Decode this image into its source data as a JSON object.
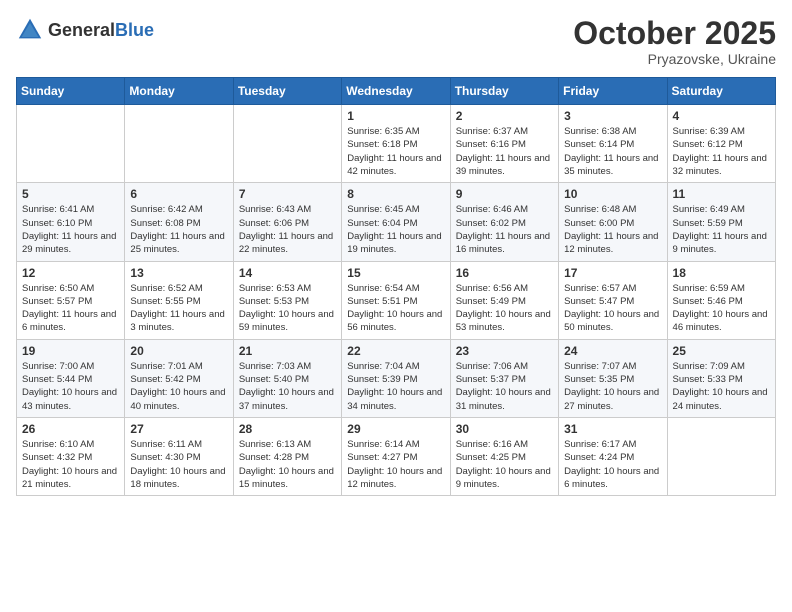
{
  "logo": {
    "text_general": "General",
    "text_blue": "Blue"
  },
  "header": {
    "month": "October 2025",
    "location": "Pryazovske, Ukraine"
  },
  "days_of_week": [
    "Sunday",
    "Monday",
    "Tuesday",
    "Wednesday",
    "Thursday",
    "Friday",
    "Saturday"
  ],
  "weeks": [
    [
      {
        "day": "",
        "sunrise": "",
        "sunset": "",
        "daylight": ""
      },
      {
        "day": "",
        "sunrise": "",
        "sunset": "",
        "daylight": ""
      },
      {
        "day": "",
        "sunrise": "",
        "sunset": "",
        "daylight": ""
      },
      {
        "day": "1",
        "sunrise": "Sunrise: 6:35 AM",
        "sunset": "Sunset: 6:18 PM",
        "daylight": "Daylight: 11 hours and 42 minutes."
      },
      {
        "day": "2",
        "sunrise": "Sunrise: 6:37 AM",
        "sunset": "Sunset: 6:16 PM",
        "daylight": "Daylight: 11 hours and 39 minutes."
      },
      {
        "day": "3",
        "sunrise": "Sunrise: 6:38 AM",
        "sunset": "Sunset: 6:14 PM",
        "daylight": "Daylight: 11 hours and 35 minutes."
      },
      {
        "day": "4",
        "sunrise": "Sunrise: 6:39 AM",
        "sunset": "Sunset: 6:12 PM",
        "daylight": "Daylight: 11 hours and 32 minutes."
      }
    ],
    [
      {
        "day": "5",
        "sunrise": "Sunrise: 6:41 AM",
        "sunset": "Sunset: 6:10 PM",
        "daylight": "Daylight: 11 hours and 29 minutes."
      },
      {
        "day": "6",
        "sunrise": "Sunrise: 6:42 AM",
        "sunset": "Sunset: 6:08 PM",
        "daylight": "Daylight: 11 hours and 25 minutes."
      },
      {
        "day": "7",
        "sunrise": "Sunrise: 6:43 AM",
        "sunset": "Sunset: 6:06 PM",
        "daylight": "Daylight: 11 hours and 22 minutes."
      },
      {
        "day": "8",
        "sunrise": "Sunrise: 6:45 AM",
        "sunset": "Sunset: 6:04 PM",
        "daylight": "Daylight: 11 hours and 19 minutes."
      },
      {
        "day": "9",
        "sunrise": "Sunrise: 6:46 AM",
        "sunset": "Sunset: 6:02 PM",
        "daylight": "Daylight: 11 hours and 16 minutes."
      },
      {
        "day": "10",
        "sunrise": "Sunrise: 6:48 AM",
        "sunset": "Sunset: 6:00 PM",
        "daylight": "Daylight: 11 hours and 12 minutes."
      },
      {
        "day": "11",
        "sunrise": "Sunrise: 6:49 AM",
        "sunset": "Sunset: 5:59 PM",
        "daylight": "Daylight: 11 hours and 9 minutes."
      }
    ],
    [
      {
        "day": "12",
        "sunrise": "Sunrise: 6:50 AM",
        "sunset": "Sunset: 5:57 PM",
        "daylight": "Daylight: 11 hours and 6 minutes."
      },
      {
        "day": "13",
        "sunrise": "Sunrise: 6:52 AM",
        "sunset": "Sunset: 5:55 PM",
        "daylight": "Daylight: 11 hours and 3 minutes."
      },
      {
        "day": "14",
        "sunrise": "Sunrise: 6:53 AM",
        "sunset": "Sunset: 5:53 PM",
        "daylight": "Daylight: 10 hours and 59 minutes."
      },
      {
        "day": "15",
        "sunrise": "Sunrise: 6:54 AM",
        "sunset": "Sunset: 5:51 PM",
        "daylight": "Daylight: 10 hours and 56 minutes."
      },
      {
        "day": "16",
        "sunrise": "Sunrise: 6:56 AM",
        "sunset": "Sunset: 5:49 PM",
        "daylight": "Daylight: 10 hours and 53 minutes."
      },
      {
        "day": "17",
        "sunrise": "Sunrise: 6:57 AM",
        "sunset": "Sunset: 5:47 PM",
        "daylight": "Daylight: 10 hours and 50 minutes."
      },
      {
        "day": "18",
        "sunrise": "Sunrise: 6:59 AM",
        "sunset": "Sunset: 5:46 PM",
        "daylight": "Daylight: 10 hours and 46 minutes."
      }
    ],
    [
      {
        "day": "19",
        "sunrise": "Sunrise: 7:00 AM",
        "sunset": "Sunset: 5:44 PM",
        "daylight": "Daylight: 10 hours and 43 minutes."
      },
      {
        "day": "20",
        "sunrise": "Sunrise: 7:01 AM",
        "sunset": "Sunset: 5:42 PM",
        "daylight": "Daylight: 10 hours and 40 minutes."
      },
      {
        "day": "21",
        "sunrise": "Sunrise: 7:03 AM",
        "sunset": "Sunset: 5:40 PM",
        "daylight": "Daylight: 10 hours and 37 minutes."
      },
      {
        "day": "22",
        "sunrise": "Sunrise: 7:04 AM",
        "sunset": "Sunset: 5:39 PM",
        "daylight": "Daylight: 10 hours and 34 minutes."
      },
      {
        "day": "23",
        "sunrise": "Sunrise: 7:06 AM",
        "sunset": "Sunset: 5:37 PM",
        "daylight": "Daylight: 10 hours and 31 minutes."
      },
      {
        "day": "24",
        "sunrise": "Sunrise: 7:07 AM",
        "sunset": "Sunset: 5:35 PM",
        "daylight": "Daylight: 10 hours and 27 minutes."
      },
      {
        "day": "25",
        "sunrise": "Sunrise: 7:09 AM",
        "sunset": "Sunset: 5:33 PM",
        "daylight": "Daylight: 10 hours and 24 minutes."
      }
    ],
    [
      {
        "day": "26",
        "sunrise": "Sunrise: 6:10 AM",
        "sunset": "Sunset: 4:32 PM",
        "daylight": "Daylight: 10 hours and 21 minutes."
      },
      {
        "day": "27",
        "sunrise": "Sunrise: 6:11 AM",
        "sunset": "Sunset: 4:30 PM",
        "daylight": "Daylight: 10 hours and 18 minutes."
      },
      {
        "day": "28",
        "sunrise": "Sunrise: 6:13 AM",
        "sunset": "Sunset: 4:28 PM",
        "daylight": "Daylight: 10 hours and 15 minutes."
      },
      {
        "day": "29",
        "sunrise": "Sunrise: 6:14 AM",
        "sunset": "Sunset: 4:27 PM",
        "daylight": "Daylight: 10 hours and 12 minutes."
      },
      {
        "day": "30",
        "sunrise": "Sunrise: 6:16 AM",
        "sunset": "Sunset: 4:25 PM",
        "daylight": "Daylight: 10 hours and 9 minutes."
      },
      {
        "day": "31",
        "sunrise": "Sunrise: 6:17 AM",
        "sunset": "Sunset: 4:24 PM",
        "daylight": "Daylight: 10 hours and 6 minutes."
      },
      {
        "day": "",
        "sunrise": "",
        "sunset": "",
        "daylight": ""
      }
    ]
  ]
}
